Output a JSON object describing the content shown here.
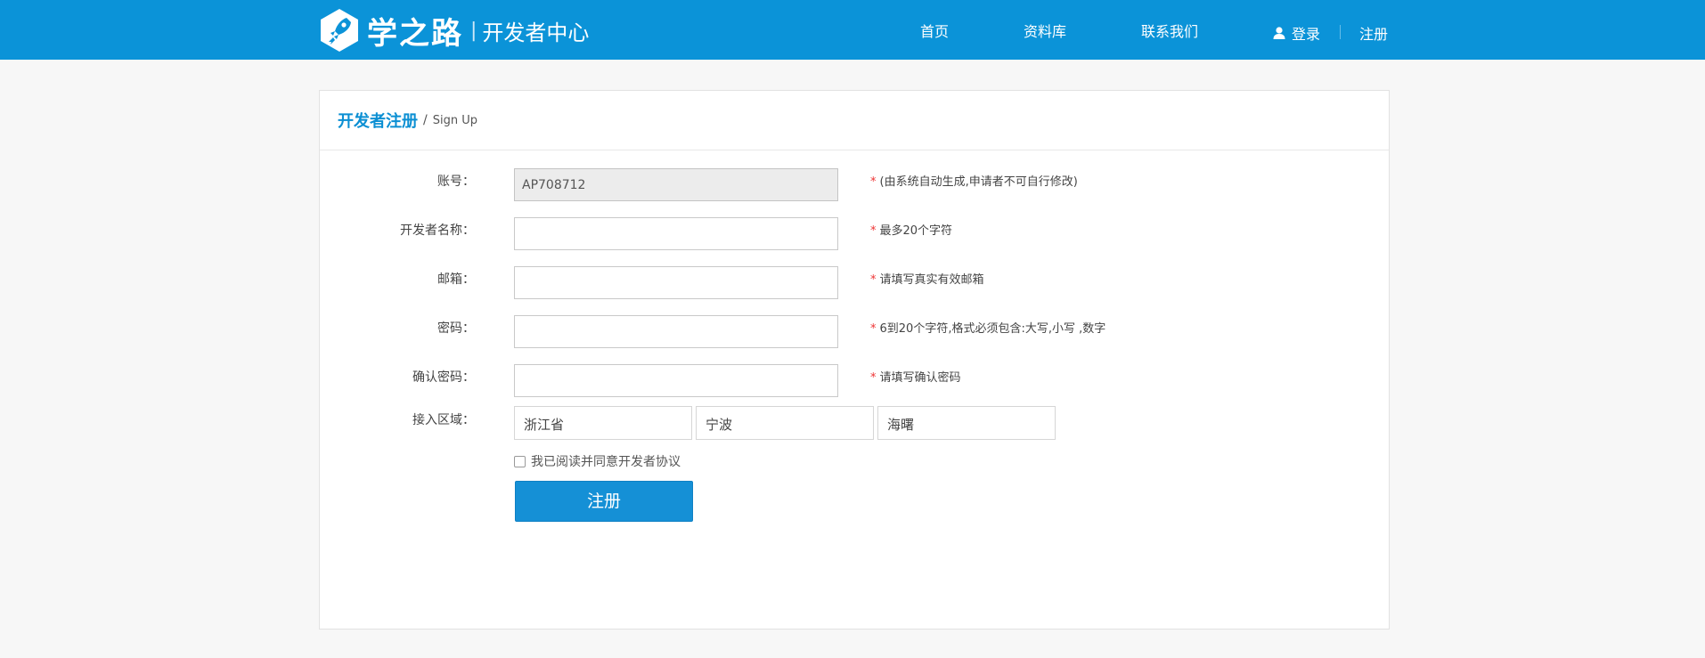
{
  "header": {
    "brand": "学之路",
    "separator": "|",
    "subtitle": "开发者中心",
    "nav": {
      "home": "首页",
      "library": "资料库",
      "contact": "联系我们",
      "login": "登录",
      "register": "注册"
    }
  },
  "panel": {
    "title": "开发者注册",
    "slash": "/",
    "title_en": "Sign Up"
  },
  "form": {
    "account": {
      "label": "账号：",
      "value": "AP708712",
      "hint": "(由系统自动生成,申请者不可自行修改)"
    },
    "dev_name": {
      "label": "开发者名称：",
      "value": "",
      "hint": "最多20个字符"
    },
    "email": {
      "label": "邮箱：",
      "value": "",
      "hint": "请填写真实有效邮箱"
    },
    "password": {
      "label": "密码：",
      "value": "",
      "hint": "6到20个字符,格式必须包含:大写,小写 ,数字"
    },
    "confirm": {
      "label": "确认密码：",
      "value": "",
      "hint": "请填写确认密码"
    },
    "region": {
      "label": "接入区域：",
      "province": "浙江省",
      "city": "宁波",
      "district": "海曙"
    },
    "required_mark": "*",
    "agree_label": "我已阅读并同意开发者协议",
    "agree_checked": false,
    "submit_label": "注册"
  },
  "colors": {
    "header_bg": "#0b93d8",
    "accent": "#0b8fd3",
    "button": "#1590d6",
    "required": "#ee3333"
  },
  "icons": {
    "logo": "rocket-hexagon-logo",
    "user": "user-icon"
  }
}
